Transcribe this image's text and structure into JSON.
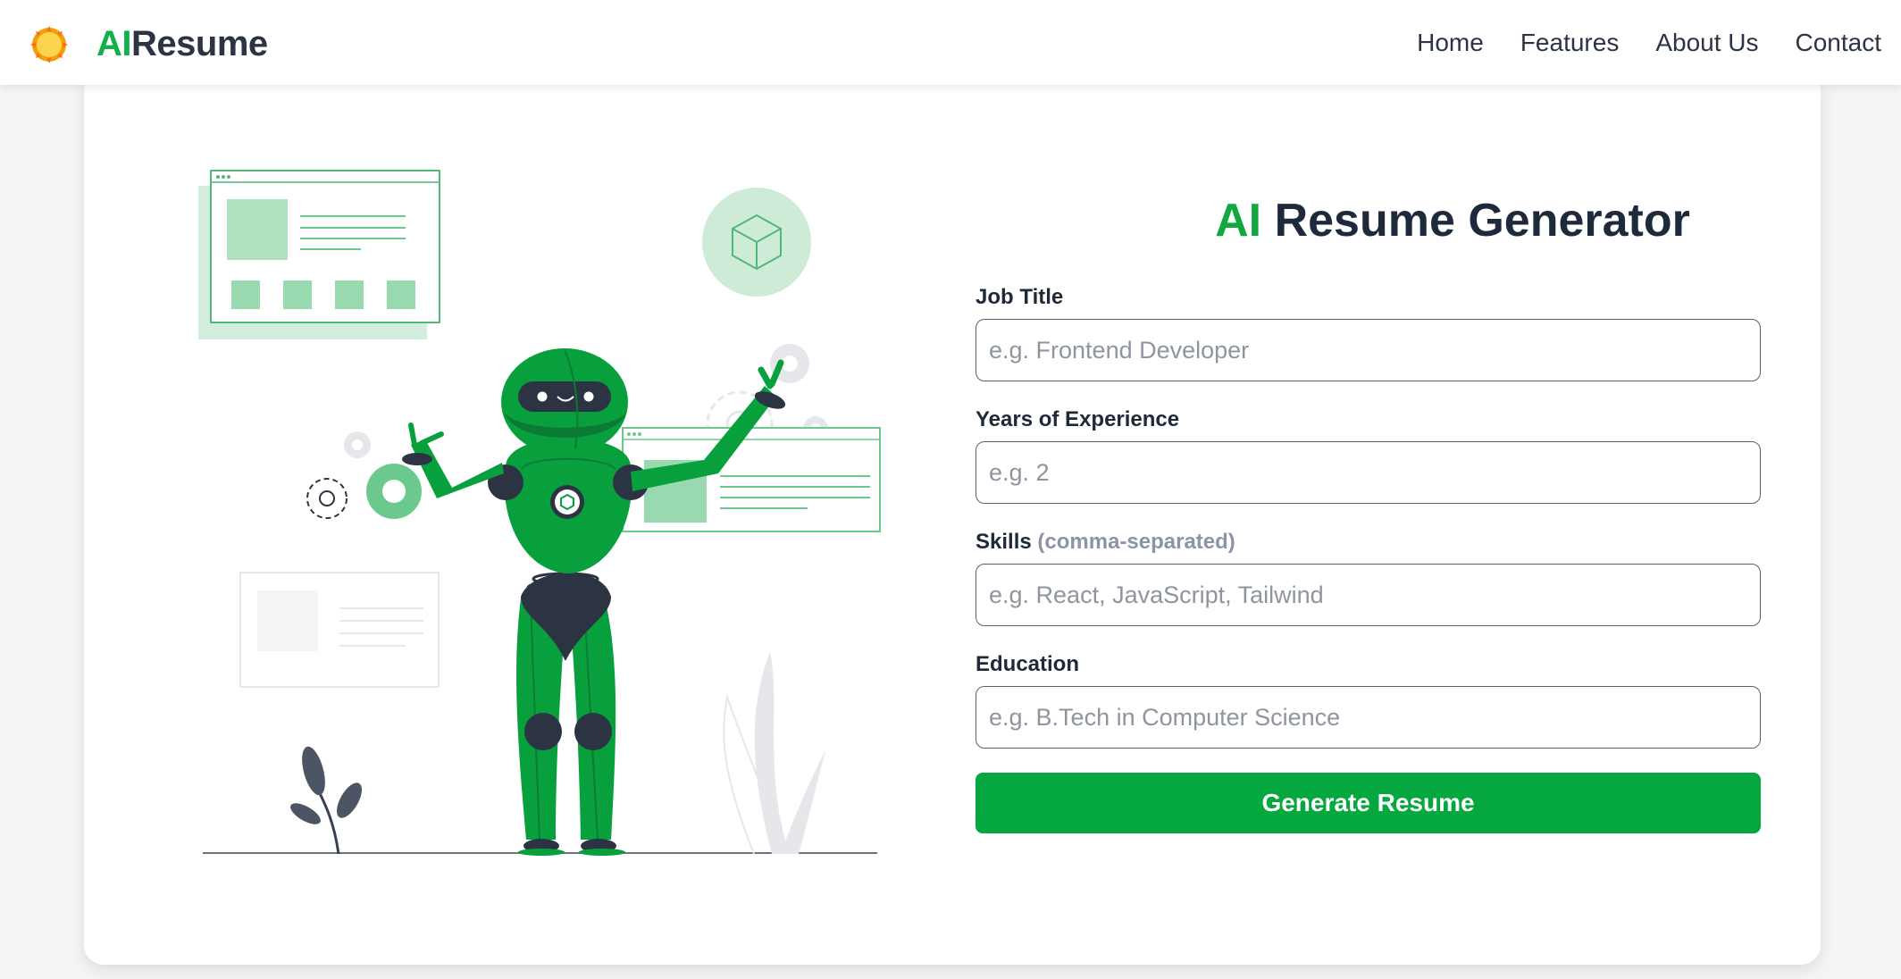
{
  "brand": {
    "name_prefix": "AI",
    "name_suffix": "Resume"
  },
  "nav": {
    "items": [
      "Home",
      "Features",
      "About Us",
      "Contact"
    ]
  },
  "form": {
    "title_accent": "AI",
    "title_rest": "Resume Generator",
    "fields": [
      {
        "label": "Job Title",
        "hint": "",
        "placeholder": "e.g. Frontend Developer",
        "value": ""
      },
      {
        "label": "Years of Experience",
        "hint": "",
        "placeholder": "e.g. 2",
        "value": ""
      },
      {
        "label": "Skills",
        "hint": "(comma-separated)",
        "placeholder": "e.g. React, JavaScript, Tailwind",
        "value": ""
      },
      {
        "label": "Education",
        "hint": "",
        "placeholder": "e.g. B.Tech in Computer Science",
        "value": ""
      }
    ],
    "submit_label": "Generate Resume"
  },
  "colors": {
    "accent_green": "#05a83e",
    "brand_green": "#10b04a",
    "heading_dark": "#1e293b",
    "page_background": "#f4f5f7",
    "logo_sun": "#fbbf24"
  },
  "icons": {
    "logo": "sun-icon",
    "illustration": "robot-illustration"
  }
}
